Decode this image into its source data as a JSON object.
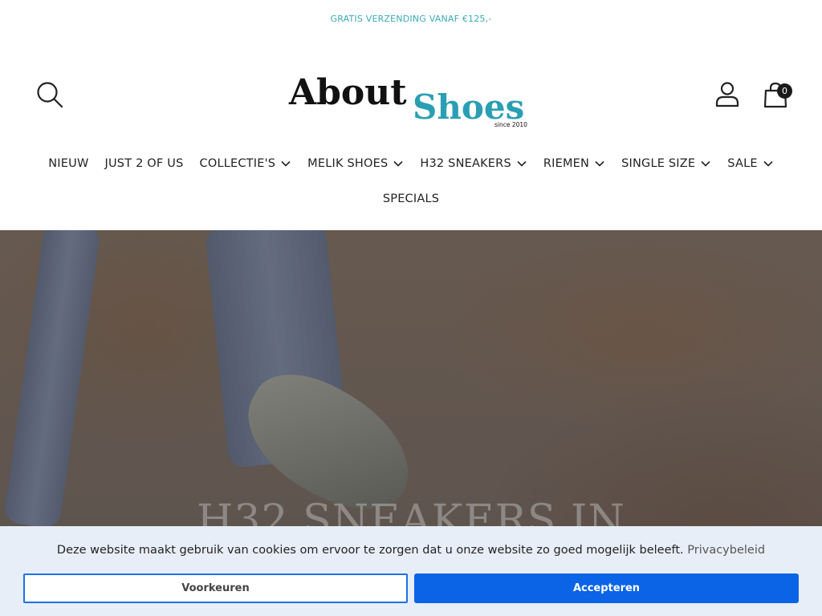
{
  "announcement": {
    "text": "GRATIS VERZENDING VANAF €125,-"
  },
  "header": {
    "logo": {
      "word1": "About",
      "word2": "Shoes",
      "tagline": "since 2010"
    },
    "search_icon": "search-icon",
    "account_icon": "account-icon",
    "cart_icon": "shopping-bag-icon",
    "cart_count": "0"
  },
  "nav": {
    "items": [
      {
        "label": "NIEUW",
        "has_dropdown": false
      },
      {
        "label": "JUST 2 OF US",
        "has_dropdown": false
      },
      {
        "label": "COLLECTIE'S",
        "has_dropdown": true
      },
      {
        "label": "MELIK SHOES",
        "has_dropdown": true
      },
      {
        "label": "H32 SNEAKERS",
        "has_dropdown": true
      },
      {
        "label": "RIEMEN",
        "has_dropdown": true
      },
      {
        "label": "SINGLE SIZE",
        "has_dropdown": true
      },
      {
        "label": "SALE",
        "has_dropdown": true
      },
      {
        "label": "SPECIALS",
        "has_dropdown": false
      }
    ]
  },
  "hero": {
    "title": "H32 SNEAKERS IN"
  },
  "cookie": {
    "message": "Deze website maakt gebruik van cookies om ervoor te zorgen dat u onze website zo goed mogelijk beleeft.",
    "link_label": "Privacybeleid",
    "preferences_label": "Voorkeuren",
    "accept_label": "Accepteren"
  },
  "colors": {
    "announcement": "#3aa9b8",
    "logo_accent": "#2a9fb3",
    "accept_button": "#0b63e5",
    "cookie_bar": "#e8eef8"
  }
}
